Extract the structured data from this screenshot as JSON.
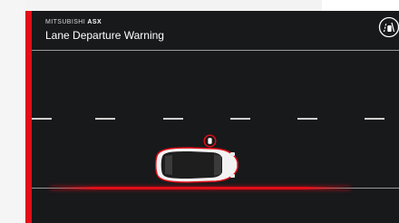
{
  "header": {
    "brand_prefix": "MITSUBISHI",
    "brand_model": "ASX",
    "title": "Lane Departure Warning"
  },
  "icons": {
    "status": "lane-assist-icon",
    "warning": "lane-departure-warning-icon",
    "vehicle": "car-topdown-icon"
  },
  "colors": {
    "accent": "#e10e18",
    "screen_background": "#18191b",
    "text": "#ffffff",
    "lane_dash": "#d0d0d0"
  }
}
